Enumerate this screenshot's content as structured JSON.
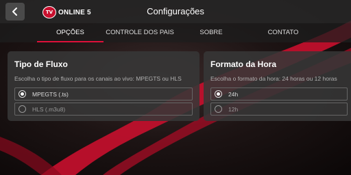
{
  "header": {
    "title": "Configurações",
    "logo_badge": "TV",
    "logo_text": "ONLINE 5"
  },
  "tabs": [
    {
      "label": "OPÇÕES",
      "active": true
    },
    {
      "label": "CONTROLE DOS PAIS",
      "active": false
    },
    {
      "label": "SOBRE",
      "active": false
    },
    {
      "label": "CONTATO",
      "active": false
    }
  ],
  "cards": [
    {
      "title": "Tipo de Fluxo",
      "description": "Escolha o tipo de fluxo para os canais ao vivo: MPEGTS ou HLS",
      "options": [
        {
          "label": "MPEGTS (.ts)",
          "selected": true
        },
        {
          "label": "HLS (.m3u8)",
          "selected": false
        }
      ]
    },
    {
      "title": "Formato da Hora",
      "description": "Escolha o formato da hora: 24 horas ou 12 horas",
      "options": [
        {
          "label": "24h",
          "selected": true
        },
        {
          "label": "12h",
          "selected": false
        }
      ]
    }
  ],
  "colors": {
    "accent": "#e0103a",
    "card_bg": "#373737",
    "swoosh": "#c8102e"
  }
}
